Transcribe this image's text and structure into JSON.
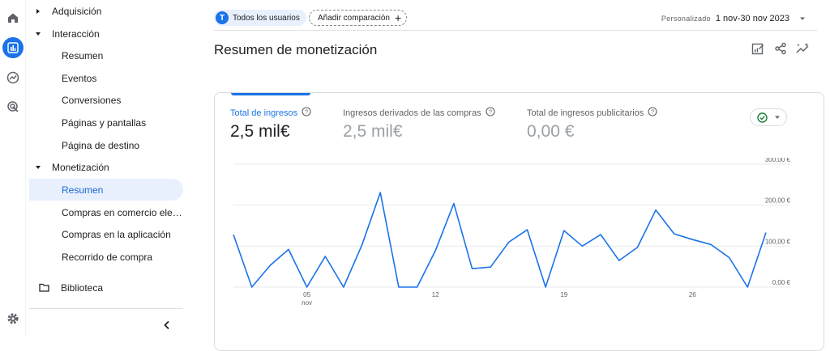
{
  "sidebar": {
    "groups": [
      {
        "label": "Adquisición",
        "expanded": false
      },
      {
        "label": "Interacción",
        "expanded": true
      },
      {
        "label": "Monetización",
        "expanded": true
      }
    ],
    "interaccion_items": [
      "Resumen",
      "Eventos",
      "Conversiones",
      "Páginas y pantallas",
      "Página de destino"
    ],
    "monetizacion_items": [
      "Resumen",
      "Compras en comercio elec...",
      "Compras en la aplicación",
      "Recorrido de compra"
    ],
    "selected": "Resumen",
    "library_label": "Biblioteca"
  },
  "topbar": {
    "audience_initial": "T",
    "audience_label": "Todos los usuarios",
    "add_comparison_label": "Añadir comparación",
    "date_label": "Personalizado",
    "date_range": "1 nov-30 nov 2023"
  },
  "page": {
    "title": "Resumen de monetización"
  },
  "metrics": [
    {
      "label": "Total de ingresos",
      "value": "2,5 mil€",
      "active": true
    },
    {
      "label": "Ingresos derivados de las compras",
      "value": "2,5 mil€",
      "active": false
    },
    {
      "label": "Total de ingresos publicitarios",
      "value": "0,00 €",
      "active": false
    }
  ],
  "colors": {
    "accent": "#1a73e8",
    "check": "#188038"
  },
  "chart_data": {
    "type": "line",
    "x": [
      1,
      2,
      3,
      4,
      5,
      6,
      7,
      8,
      9,
      10,
      11,
      12,
      13,
      14,
      15,
      16,
      17,
      18,
      19,
      20,
      21,
      22,
      23,
      24,
      25,
      26,
      27,
      28,
      29,
      30
    ],
    "y": [
      128,
      0,
      53,
      92,
      0,
      75,
      0,
      103,
      231,
      0,
      0,
      89,
      204,
      45,
      49,
      110,
      140,
      0,
      138,
      100,
      128,
      65,
      97,
      188,
      130,
      116,
      104,
      72,
      0,
      133
    ],
    "x_ticks": [
      {
        "day": 5,
        "label": "05",
        "sublabel": "nov"
      },
      {
        "day": 12,
        "label": "12"
      },
      {
        "day": 19,
        "label": "19"
      },
      {
        "day": 26,
        "label": "26"
      }
    ],
    "y_ticks": [
      "300,00 €",
      "200,00 €",
      "100,00 €",
      "0,00 €"
    ],
    "ylim": [
      0,
      300
    ],
    "grid": true
  }
}
